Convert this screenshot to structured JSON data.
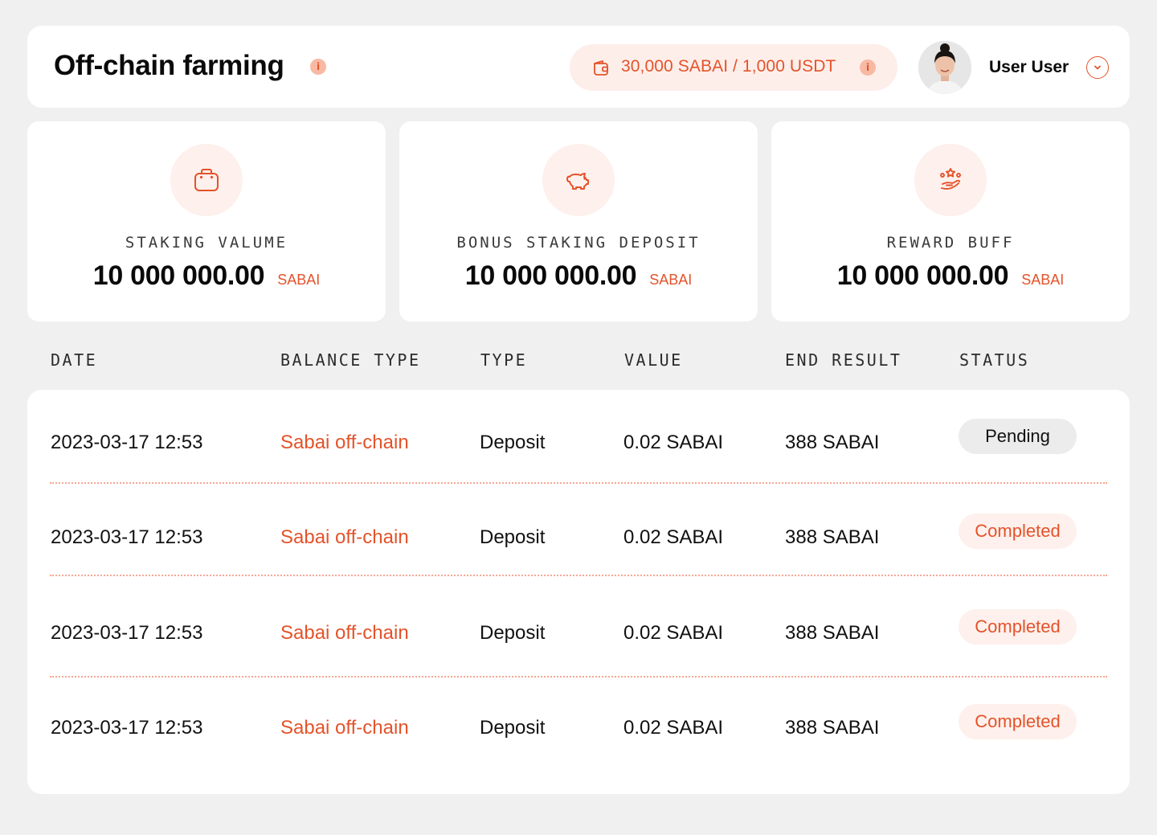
{
  "header": {
    "title": "Off-chain farming",
    "title_info_icon": "info-icon",
    "balance_icon": "wallet-icon",
    "balance": "30,000 SABAI / 1,000 USDT",
    "balance_info_icon": "info-icon",
    "info_glyph": "i",
    "user": {
      "avatar": "user-avatar",
      "name": "User User",
      "dropdown_icon": "chevron-down-icon"
    }
  },
  "stats": [
    {
      "icon": "briefcase-icon",
      "label": "STAKING VALUME",
      "value": "10 000 000.00",
      "unit": "SABAI"
    },
    {
      "icon": "piggy-bank-icon",
      "label": "BONUS STAKING DEPOSIT",
      "value": "10 000 000.00",
      "unit": "SABAI"
    },
    {
      "icon": "reward-stars-hand-icon",
      "label": "REWARD BUFF",
      "value": "10 000 000.00",
      "unit": "SABAI"
    }
  ],
  "table": {
    "columns": [
      "DATE",
      "BALANCE TYPE",
      "TYPE",
      "VALUE",
      "END RESULT",
      "STATUS"
    ],
    "rows": [
      {
        "date": "2023-03-17 12:53",
        "balance_type": "Sabai off-chain",
        "type": "Deposit",
        "value": "0.02 SABAI",
        "end_result": "388 SABAI",
        "status": "Pending"
      },
      {
        "date": "2023-03-17 12:53",
        "balance_type": "Sabai off-chain",
        "type": "Deposit",
        "value": "0.02 SABAI",
        "end_result": "388 SABAI",
        "status": "Completed"
      },
      {
        "date": "2023-03-17 12:53",
        "balance_type": "Sabai off-chain",
        "type": "Deposit",
        "value": "0.02 SABAI",
        "end_result": "388 SABAI",
        "status": "Completed"
      },
      {
        "date": "2023-03-17 12:53",
        "balance_type": "Sabai off-chain",
        "type": "Deposit",
        "value": "0.02 SABAI",
        "end_result": "388 SABAI",
        "status": "Completed"
      }
    ]
  },
  "colors": {
    "accent": "#e4532a",
    "accent_soft": "#fef0ec",
    "background": "#f0f0f0",
    "pending_bg": "#ececec"
  }
}
